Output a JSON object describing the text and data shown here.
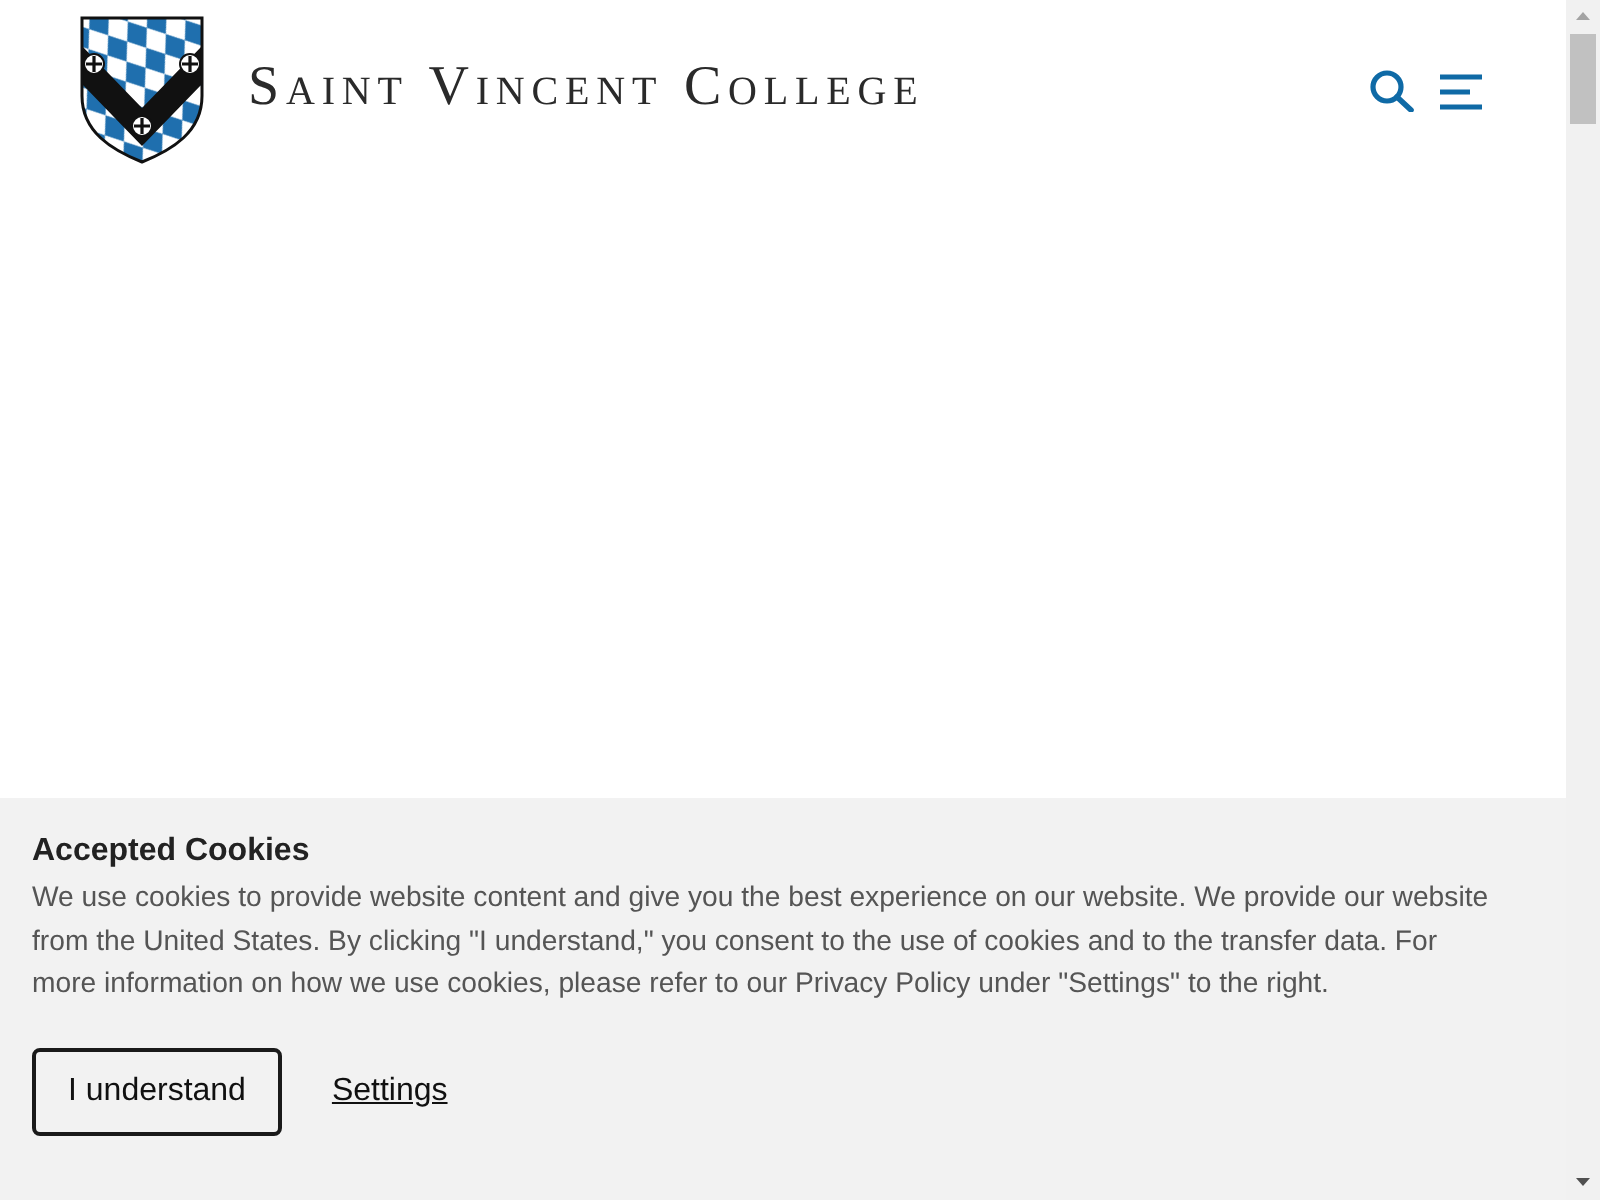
{
  "header": {
    "site_title": "Saint Vincent College"
  },
  "cookie_banner": {
    "title": "Accepted Cookies",
    "text": "We use cookies to provide website content and give you the best experience on our website. We provide our website from the United States. By clicking \"I understand,\" you consent to the use of cookies and to the transfer data. For more information on how we use cookies, please refer to our Privacy Policy under \"Settings\" to the right.",
    "actions": [
      {
        "kind": "button",
        "label": "I understand"
      },
      {
        "kind": "link",
        "label": "Settings"
      }
    ]
  }
}
